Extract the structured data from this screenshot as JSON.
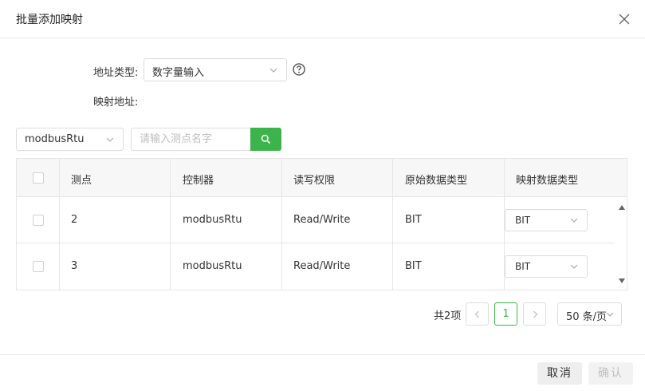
{
  "dialog": {
    "title": "批量添加映射"
  },
  "form": {
    "address_type_label": "地址类型:",
    "address_type_value": "数字量输入",
    "mapping_address_label": "映射地址:"
  },
  "filter": {
    "controller_value": "modbusRtu",
    "search_placeholder": "请输入测点名字"
  },
  "table": {
    "headers": {
      "point": "测点",
      "controller": "控制器",
      "access": "读写权限",
      "source_type": "原始数据类型",
      "mapped_type": "映射数据类型"
    },
    "rows": [
      {
        "point": "2",
        "controller": "modbusRtu",
        "access": "Read/Write",
        "source_type": "BIT",
        "mapped_type": "BIT"
      },
      {
        "point": "3",
        "controller": "modbusRtu",
        "access": "Read/Write",
        "source_type": "BIT",
        "mapped_type": "BIT"
      }
    ]
  },
  "pagination": {
    "total": "共2项",
    "current_page": "1",
    "page_size": "50 条/页"
  },
  "footer": {
    "cancel_label": "取消",
    "confirm_label": "确认"
  },
  "colors": {
    "accent": "#3cb44b",
    "border": "#dcdcdc",
    "header_bg": "#f7f7f7"
  },
  "icons": {
    "close": "close-icon",
    "help": "help-icon",
    "search": "search-icon",
    "chevron": "chevron-down-icon",
    "prev": "chevron-left-icon",
    "next": "chevron-right-icon"
  }
}
